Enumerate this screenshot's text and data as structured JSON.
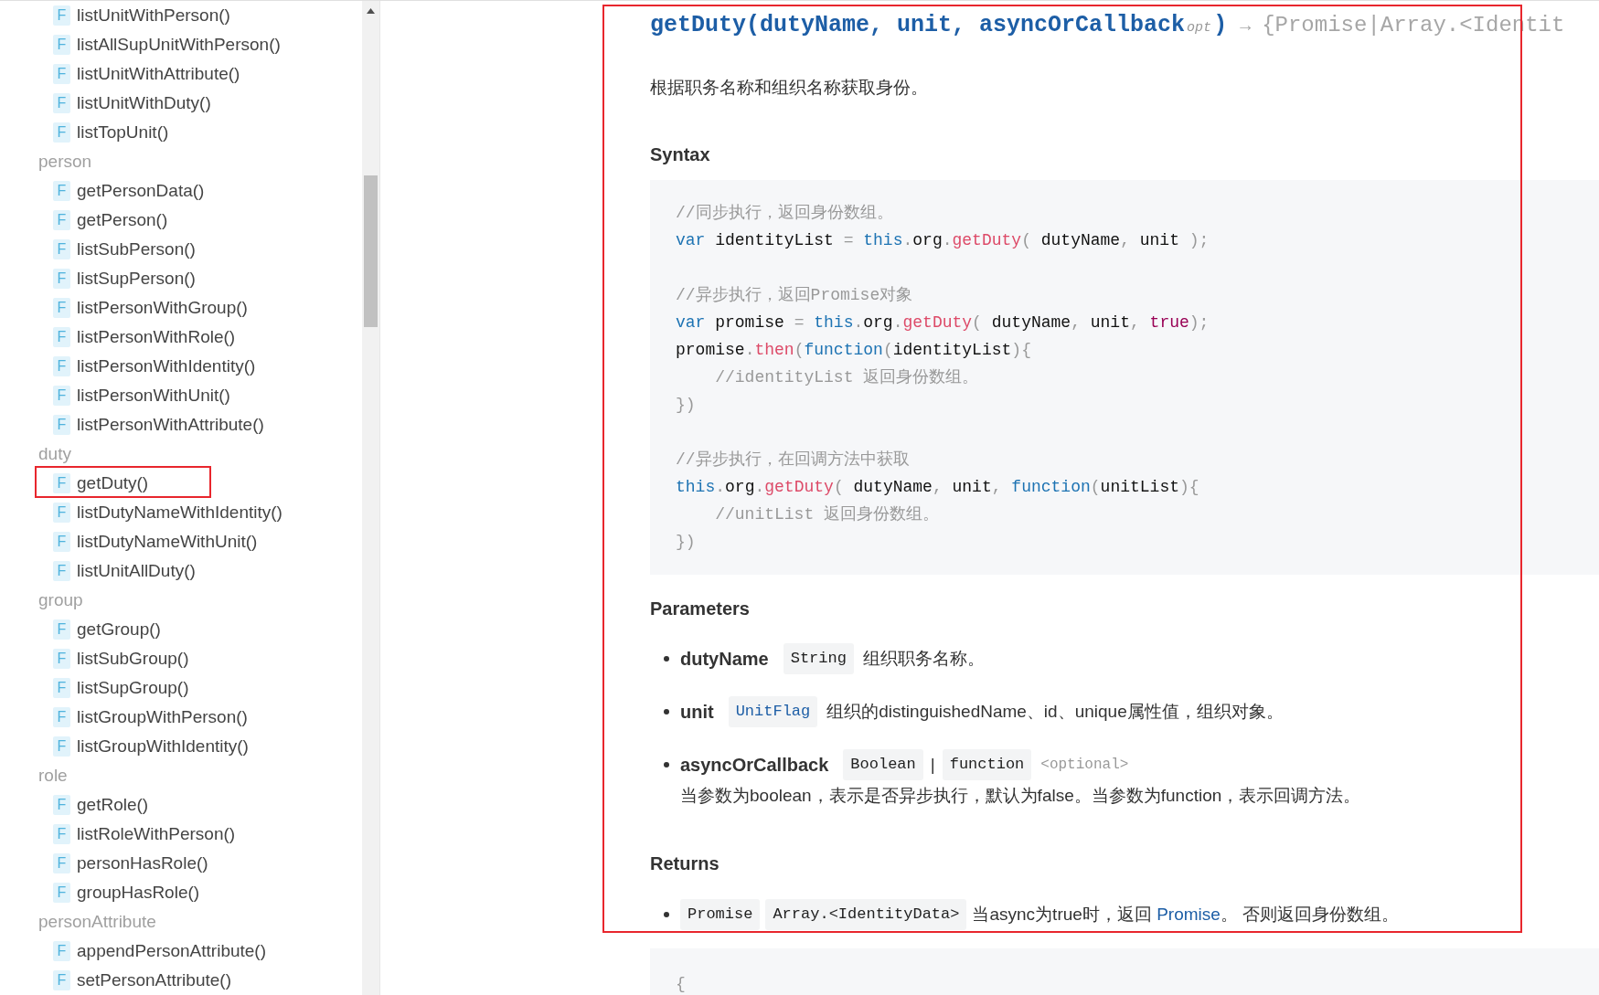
{
  "sidebar": {
    "sections": [
      {
        "items": [
          {
            "badge": "F",
            "name": "listUnitWithPerson()",
            "highlighted": false
          },
          {
            "badge": "F",
            "name": "listAllSupUnitWithPerson()",
            "highlighted": false
          },
          {
            "badge": "F",
            "name": "listUnitWithAttribute()",
            "highlighted": false
          },
          {
            "badge": "F",
            "name": "listUnitWithDuty()",
            "highlighted": false
          },
          {
            "badge": "F",
            "name": "listTopUnit()",
            "highlighted": false
          }
        ]
      },
      {
        "label": "person",
        "items": [
          {
            "badge": "F",
            "name": "getPersonData()",
            "highlighted": false
          },
          {
            "badge": "F",
            "name": "getPerson()",
            "highlighted": false
          },
          {
            "badge": "F",
            "name": "listSubPerson()",
            "highlighted": false
          },
          {
            "badge": "F",
            "name": "listSupPerson()",
            "highlighted": false
          },
          {
            "badge": "F",
            "name": "listPersonWithGroup()",
            "highlighted": false
          },
          {
            "badge": "F",
            "name": "listPersonWithRole()",
            "highlighted": false
          },
          {
            "badge": "F",
            "name": "listPersonWithIdentity()",
            "highlighted": false
          },
          {
            "badge": "F",
            "name": "listPersonWithUnit()",
            "highlighted": false
          },
          {
            "badge": "F",
            "name": "listPersonWithAttribute()",
            "highlighted": false
          }
        ]
      },
      {
        "label": "duty",
        "items": [
          {
            "badge": "F",
            "name": "getDuty()",
            "highlighted": true
          },
          {
            "badge": "F",
            "name": "listDutyNameWithIdentity()",
            "highlighted": false
          },
          {
            "badge": "F",
            "name": "listDutyNameWithUnit()",
            "highlighted": false
          },
          {
            "badge": "F",
            "name": "listUnitAllDuty()",
            "highlighted": false
          }
        ]
      },
      {
        "label": "group",
        "items": [
          {
            "badge": "F",
            "name": "getGroup()",
            "highlighted": false
          },
          {
            "badge": "F",
            "name": "listSubGroup()",
            "highlighted": false
          },
          {
            "badge": "F",
            "name": "listSupGroup()",
            "highlighted": false
          },
          {
            "badge": "F",
            "name": "listGroupWithPerson()",
            "highlighted": false
          },
          {
            "badge": "F",
            "name": "listGroupWithIdentity()",
            "highlighted": false
          }
        ]
      },
      {
        "label": "role",
        "items": [
          {
            "badge": "F",
            "name": "getRole()",
            "highlighted": false
          },
          {
            "badge": "F",
            "name": "listRoleWithPerson()",
            "highlighted": false
          },
          {
            "badge": "F",
            "name": "personHasRole()",
            "highlighted": false
          },
          {
            "badge": "F",
            "name": "groupHasRole()",
            "highlighted": false
          }
        ]
      },
      {
        "label": "personAttribute",
        "items": [
          {
            "badge": "F",
            "name": "appendPersonAttribute()",
            "highlighted": false
          },
          {
            "badge": "F",
            "name": "setPersonAttribute()",
            "highlighted": false
          }
        ]
      }
    ]
  },
  "content": {
    "highlighted": true,
    "signature": {
      "text": "getDuty(dutyName, unit, asyncOrCallback",
      "optional_mark": "opt",
      "close": ")",
      "arrow": "→",
      "returns": "{Promise|Array.<Identit"
    },
    "description": "根据职务名称和组织名称获取身份。",
    "syntax_heading": "Syntax",
    "code": [
      [
        [
          {
            "kind": "comment",
            "text": "//同步执行，返回身份数组。"
          }
        ],
        [
          {
            "kind": "keyword",
            "text": "var"
          },
          {
            "kind": "plain",
            "text": " identityList "
          },
          {
            "kind": "punct",
            "text": "= "
          },
          {
            "kind": "keyword",
            "text": "this"
          },
          {
            "kind": "punct",
            "text": "."
          },
          {
            "kind": "plain",
            "text": "org"
          },
          {
            "kind": "punct",
            "text": "."
          },
          {
            "kind": "func",
            "text": "getDuty"
          },
          {
            "kind": "punct",
            "text": "("
          },
          {
            "kind": "plain",
            "text": " dutyName"
          },
          {
            "kind": "punct",
            "text": ","
          },
          {
            "kind": "plain",
            "text": " unit "
          },
          {
            "kind": "punct",
            "text": ");"
          }
        ]
      ],
      [
        [
          {
            "kind": "comment",
            "text": "//异步执行，返回Promise对象"
          }
        ],
        [
          {
            "kind": "keyword",
            "text": "var"
          },
          {
            "kind": "plain",
            "text": " promise "
          },
          {
            "kind": "punct",
            "text": "= "
          },
          {
            "kind": "keyword",
            "text": "this"
          },
          {
            "kind": "punct",
            "text": "."
          },
          {
            "kind": "plain",
            "text": "org"
          },
          {
            "kind": "punct",
            "text": "."
          },
          {
            "kind": "func",
            "text": "getDuty"
          },
          {
            "kind": "punct",
            "text": "("
          },
          {
            "kind": "plain",
            "text": " dutyName"
          },
          {
            "kind": "punct",
            "text": ","
          },
          {
            "kind": "plain",
            "text": " unit"
          },
          {
            "kind": "punct",
            "text": ", "
          },
          {
            "kind": "literal",
            "text": "true"
          },
          {
            "kind": "punct",
            "text": ");"
          }
        ],
        [
          {
            "kind": "plain",
            "text": "promise"
          },
          {
            "kind": "punct",
            "text": "."
          },
          {
            "kind": "func",
            "text": "then"
          },
          {
            "kind": "punct",
            "text": "("
          },
          {
            "kind": "keyword",
            "text": "function"
          },
          {
            "kind": "punct",
            "text": "("
          },
          {
            "kind": "plain",
            "text": "identityList"
          },
          {
            "kind": "punct",
            "text": "){"
          }
        ],
        [
          {
            "kind": "comment",
            "text": "    //identityList 返回身份数组。"
          }
        ],
        [
          {
            "kind": "punct",
            "text": "})"
          }
        ]
      ],
      [
        [
          {
            "kind": "comment",
            "text": "//异步执行，在回调方法中获取"
          }
        ],
        [
          {
            "kind": "keyword",
            "text": "this"
          },
          {
            "kind": "punct",
            "text": "."
          },
          {
            "kind": "plain",
            "text": "org"
          },
          {
            "kind": "punct",
            "text": "."
          },
          {
            "kind": "func",
            "text": "getDuty"
          },
          {
            "kind": "punct",
            "text": "("
          },
          {
            "kind": "plain",
            "text": " dutyName"
          },
          {
            "kind": "punct",
            "text": ","
          },
          {
            "kind": "plain",
            "text": " unit"
          },
          {
            "kind": "punct",
            "text": ", "
          },
          {
            "kind": "keyword",
            "text": "function"
          },
          {
            "kind": "punct",
            "text": "("
          },
          {
            "kind": "plain",
            "text": "unitList"
          },
          {
            "kind": "punct",
            "text": "){"
          }
        ],
        [
          {
            "kind": "comment",
            "text": "    //unitList 返回身份数组。"
          }
        ],
        [
          {
            "kind": "punct",
            "text": "})"
          }
        ]
      ]
    ],
    "parameters_heading": "Parameters",
    "parameters": [
      {
        "name": "dutyName",
        "types": [
          {
            "text": "String",
            "link": false
          }
        ],
        "description": "组织职务名称。"
      },
      {
        "name": "unit",
        "types": [
          {
            "text": "UnitFlag",
            "link": true
          }
        ],
        "description": "组织的distinguishedName、id、unique属性值，组织对象。"
      },
      {
        "name": "asyncOrCallback",
        "types": [
          {
            "text": "Boolean",
            "link": false
          },
          {
            "text": "function",
            "link": false
          }
        ],
        "type_separator": "|",
        "optional": "<optional>",
        "note": "当参数为boolean，表示是否异步执行，默认为false。当参数为function，表示回调方法。"
      }
    ],
    "returns_heading": "Returns",
    "returns": {
      "types": [
        {
          "text": "Promise",
          "link": false
        },
        {
          "text": "Array.<IdentityData>",
          "link": false
        }
      ],
      "description": [
        {
          "text": "当async为true时，返回 ",
          "link": false
        },
        {
          "text": "Promise",
          "link": true
        },
        {
          "text": "。 否则返回身份数组。",
          "link": false
        }
      ]
    },
    "example_code": "{"
  }
}
